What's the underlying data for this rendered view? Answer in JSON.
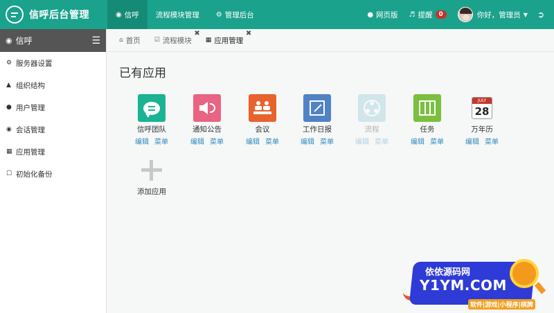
{
  "brand": {
    "title": "信呼后台管理"
  },
  "topnav": [
    {
      "label": "信呼",
      "icon": "chat-icon",
      "active": true
    },
    {
      "label": "流程模块管理"
    },
    {
      "label": "管理后台",
      "icon": "gear-icon"
    }
  ],
  "topright": {
    "web_label": "网页版",
    "remind_label": "提醒",
    "remind_count": "0",
    "greeting": "你好，管理员"
  },
  "sidebar": {
    "title": "信呼",
    "items": [
      {
        "label": "服务器设置",
        "icon": "gear-icon"
      },
      {
        "label": "组织结构",
        "icon": "sitemap-icon"
      },
      {
        "label": "用户管理",
        "icon": "user-icon"
      },
      {
        "label": "会话管理",
        "icon": "comments-icon"
      },
      {
        "label": "应用管理",
        "icon": "grid-icon"
      },
      {
        "label": "初始化备份",
        "icon": "bookmark-icon"
      }
    ]
  },
  "tabs": [
    {
      "label": "首页",
      "icon": "home-icon"
    },
    {
      "label": "流程模块",
      "icon": "check-icon",
      "closable": true
    },
    {
      "label": "应用管理",
      "icon": "grid-icon",
      "closable": true,
      "active": true
    }
  ],
  "main": {
    "title": "已有应用",
    "apps": [
      {
        "name": "信呼团队",
        "edit": "编辑",
        "menu": "菜单",
        "color": "#1ab394"
      },
      {
        "name": "通知公告",
        "edit": "编辑",
        "menu": "菜单",
        "color": "#e96482"
      },
      {
        "name": "会议",
        "edit": "编辑",
        "menu": "菜单",
        "color": "#e7622d"
      },
      {
        "name": "工作日报",
        "edit": "编辑",
        "menu": "菜单",
        "color": "#4f83c4"
      },
      {
        "name": "流程",
        "edit": "编辑",
        "menu": "菜单",
        "color": "#8ec9d3"
      },
      {
        "name": "任务",
        "edit": "编辑",
        "menu": "菜单",
        "color": "#7cbf3f"
      },
      {
        "name": "万年历",
        "edit": "编辑",
        "menu": "菜单",
        "cal_month": "JULY",
        "cal_day": "28"
      }
    ],
    "add_label": "添加应用"
  },
  "watermark": {
    "line1": "依依源码网",
    "line2": "Y1YM.COM",
    "line3": "软件|游戏|小程序|棋牌"
  }
}
